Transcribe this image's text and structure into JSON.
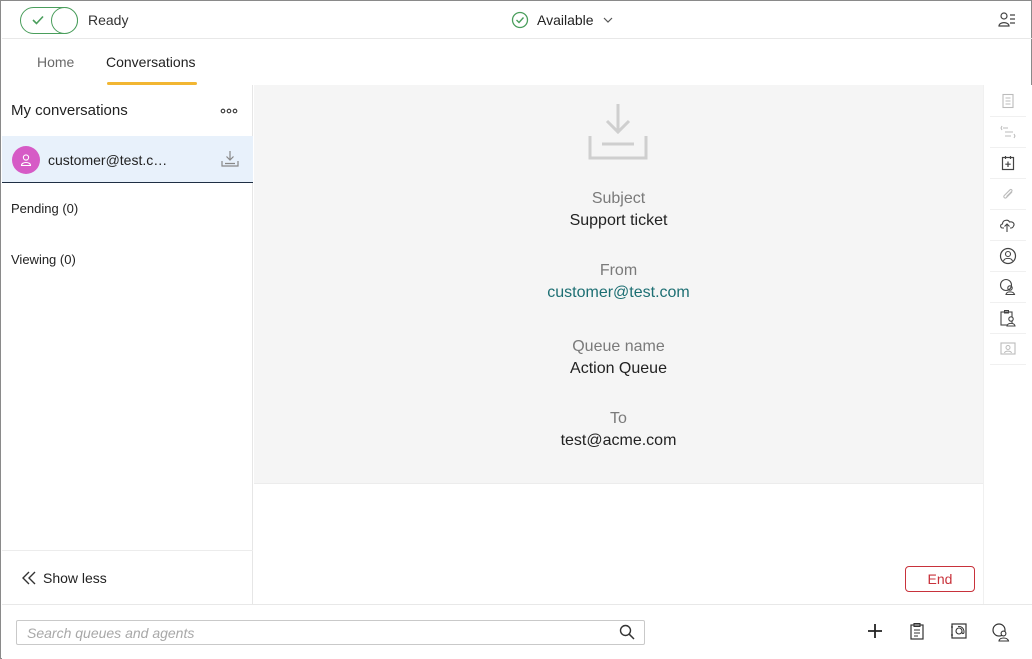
{
  "topbar": {
    "ready_label": "Ready",
    "status_label": "Available"
  },
  "tabs": [
    {
      "label": "Home"
    },
    {
      "label": "Conversations"
    }
  ],
  "sidebar": {
    "title": "My conversations",
    "active_conversation": "customer@test.c…",
    "pending_label": "Pending (0)",
    "viewing_label": "Viewing (0)",
    "show_less_label": "Show less"
  },
  "details": {
    "subject_label": "Subject",
    "subject_value": "Support ticket",
    "from_label": "From",
    "from_value": "customer@test.com",
    "queue_label": "Queue name",
    "queue_value": "Action Queue",
    "to_label": "To",
    "to_value": "test@acme.com"
  },
  "actions": {
    "end_label": "End"
  },
  "search": {
    "placeholder": "Search queues and agents"
  },
  "colors": {
    "accent_tab": "#f2b632",
    "ready_green": "#4a9e5c",
    "end_red": "#c8323b",
    "link_teal": "#1d6f73",
    "avatar_pink": "#d65bc6"
  },
  "icons": {
    "rail": [
      "notes-icon",
      "transcript-icon",
      "add-task-icon",
      "attachment-icon",
      "upload-cloud-icon",
      "contact-icon",
      "contact-search-icon",
      "contact-card-icon",
      "contact-frame-icon"
    ],
    "bottom": [
      "add-icon",
      "clipboard-icon",
      "email-channel-icon",
      "agent-search-icon"
    ]
  }
}
